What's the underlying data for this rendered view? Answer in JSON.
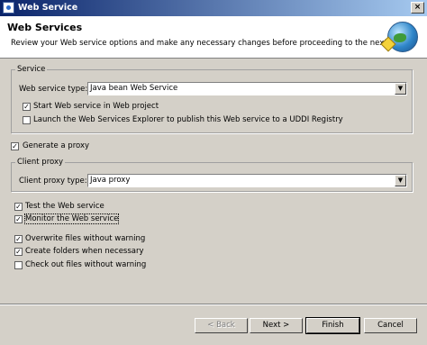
{
  "window": {
    "title": "Web Service",
    "close_label": "×"
  },
  "header": {
    "title": "Web Services",
    "description": "Review your Web service options and make any necessary changes before proceeding to the next page."
  },
  "service": {
    "group_label": "Service",
    "type_label": "Web service type:",
    "type_value": "Java bean Web Service",
    "start_label": "Start Web service in Web project",
    "start_checked": true,
    "launch_label": "Launch the Web Services Explorer to publish this Web service to a UDDI Registry",
    "launch_checked": false
  },
  "proxy": {
    "generate_label": "Generate a proxy",
    "generate_checked": true,
    "group_label": "Client proxy",
    "type_label": "Client proxy type:",
    "type_value": "Java proxy"
  },
  "options": [
    {
      "label": "Test the Web service",
      "checked": true
    },
    {
      "label": "Monitor the Web service",
      "checked": true
    },
    {
      "label": "Overwrite files without warning",
      "checked": true
    },
    {
      "label": "Create folders when necessary",
      "checked": true
    },
    {
      "label": "Check out files without warning",
      "checked": false
    }
  ],
  "buttons": {
    "back": "< Back",
    "next": "Next >",
    "finish": "Finish",
    "cancel": "Cancel"
  }
}
